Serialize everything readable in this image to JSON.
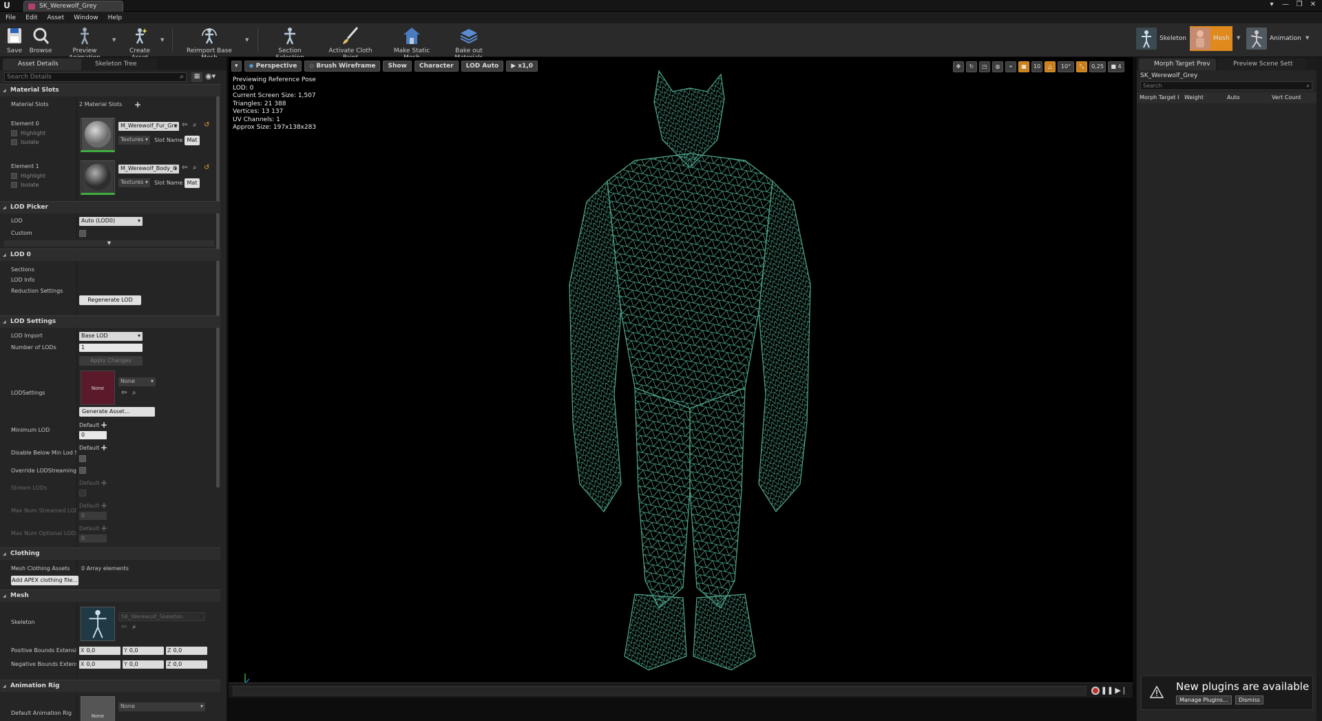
{
  "window": {
    "logo": "U",
    "tab_title": "SK_Werewolf_Grey",
    "controls": [
      "▾",
      "—",
      "❐",
      "✕"
    ]
  },
  "menu": [
    "File",
    "Edit",
    "Asset",
    "Window",
    "Help"
  ],
  "toolbar": {
    "save": "Save",
    "browse": "Browse",
    "preview_animation": "Preview Animation",
    "create_asset": "Create Asset",
    "reimport": "Reimport Base Mesh",
    "section_selection": "Section Selection",
    "activate_cloth": "Activate Cloth Paint",
    "make_static": "Make Static Mesh",
    "bake_materials": "Bake out Materials",
    "modes": {
      "skeleton": "Skeleton",
      "mesh": "Mesh",
      "animation": "Animation"
    }
  },
  "left_panel": {
    "tabs": {
      "asset_details": "Asset Details",
      "skeleton_tree": "Skeleton Tree"
    },
    "search_placeholder": "Search Details",
    "material_slots": {
      "header": "Material Slots",
      "label": "Material Slots",
      "count": "2 Material Slots",
      "elements": [
        {
          "label": "Element 0",
          "material": "M_Werewolf_Fur_Gre",
          "textures": "Textures",
          "slot_name_label": "Slot Name",
          "slot_value": "Mat",
          "highlight": "Highlight",
          "isolate": "Isolate"
        },
        {
          "label": "Element 1",
          "material": "M_Werewolf_Body_G",
          "textures": "Textures",
          "slot_name_label": "Slot Name",
          "slot_value": "Mat",
          "highlight": "Highlight",
          "isolate": "Isolate"
        }
      ]
    },
    "lod_picker": {
      "header": "LOD Picker",
      "lod_label": "LOD",
      "lod_value": "Auto (LOD0)",
      "custom_label": "Custom"
    },
    "lod0": {
      "header": "LOD 0",
      "sections": "Sections",
      "lod_info": "LOD Info",
      "reduction": "Reduction Settings",
      "regenerate": "Regenerate LOD"
    },
    "lod_settings": {
      "header": "LOD Settings",
      "lod_import_label": "LOD Import",
      "lod_import_value": "Base LOD",
      "num_lods_label": "Number of LODs",
      "num_lods_value": "1",
      "apply_changes": "Apply Changes",
      "lodsettings_label": "LODSettings",
      "lodsettings_thumb": "None",
      "lodsettings_value": "None",
      "generate_asset": "Generate Asset...",
      "min_lod_label": "Minimum LOD",
      "default": "Default",
      "min_lod_value": "0",
      "disable_below_label": "Disable Below Min Lod St",
      "override_streaming_label": "Override LODStreaming S",
      "stream_lods_label": "Stream LODs",
      "max_streamed_label": "Max Num Streamed LOD",
      "max_streamed_value": "0",
      "max_optional_label": "Max Num Optional LODs",
      "max_optional_value": "0"
    },
    "clothing": {
      "header": "Clothing",
      "assets_label": "Mesh Clothing Assets",
      "assets_value": "0 Array elements",
      "add_apex": "Add APEX clothing file..."
    },
    "mesh": {
      "header": "Mesh",
      "skeleton_label": "Skeleton",
      "skeleton_value": "SK_Werewolf_Skeleton",
      "pos_bounds_label": "Positive Bounds Extensic",
      "neg_bounds_label": "Negative Bounds Extensi",
      "x": "X",
      "y": "Y",
      "z": "Z",
      "bound_value": "0,0"
    },
    "anim_rig": {
      "header": "Animation Rig",
      "default_rig_label": "Default Animation Rig",
      "value": "None",
      "thumb": "None"
    }
  },
  "viewport": {
    "buttons": {
      "menu": "▾",
      "perspective": "Perspective",
      "brush_wireframe": "Brush Wireframe",
      "show": "Show",
      "character": "Character",
      "lod_auto": "LOD Auto",
      "speed": "x1,0"
    },
    "right_controls": {
      "grid": "10",
      "angle": "10°",
      "scale": "0,25",
      "camera_speed": "4"
    },
    "info": [
      "Previewing Reference Pose",
      "LOD: 0",
      "Current Screen Size: 1,507",
      "Triangles: 21 388",
      "Vertices: 13 137",
      "UV Channels: 1",
      "Approx Size: 197x138x283"
    ],
    "mesh_color": "#4fa88e"
  },
  "right_panel": {
    "tabs": {
      "morph": "Morph Target Prev",
      "scene": "Preview Scene Sett"
    },
    "asset_name": "SK_Werewolf_Grey",
    "search_placeholder": "Search",
    "columns": [
      "Morph Target I",
      "Weight",
      "Auto",
      "Vert Count"
    ],
    "notification": {
      "title": "New plugins are available",
      "manage": "Manage Plugins...",
      "dismiss": "Dismiss"
    }
  }
}
